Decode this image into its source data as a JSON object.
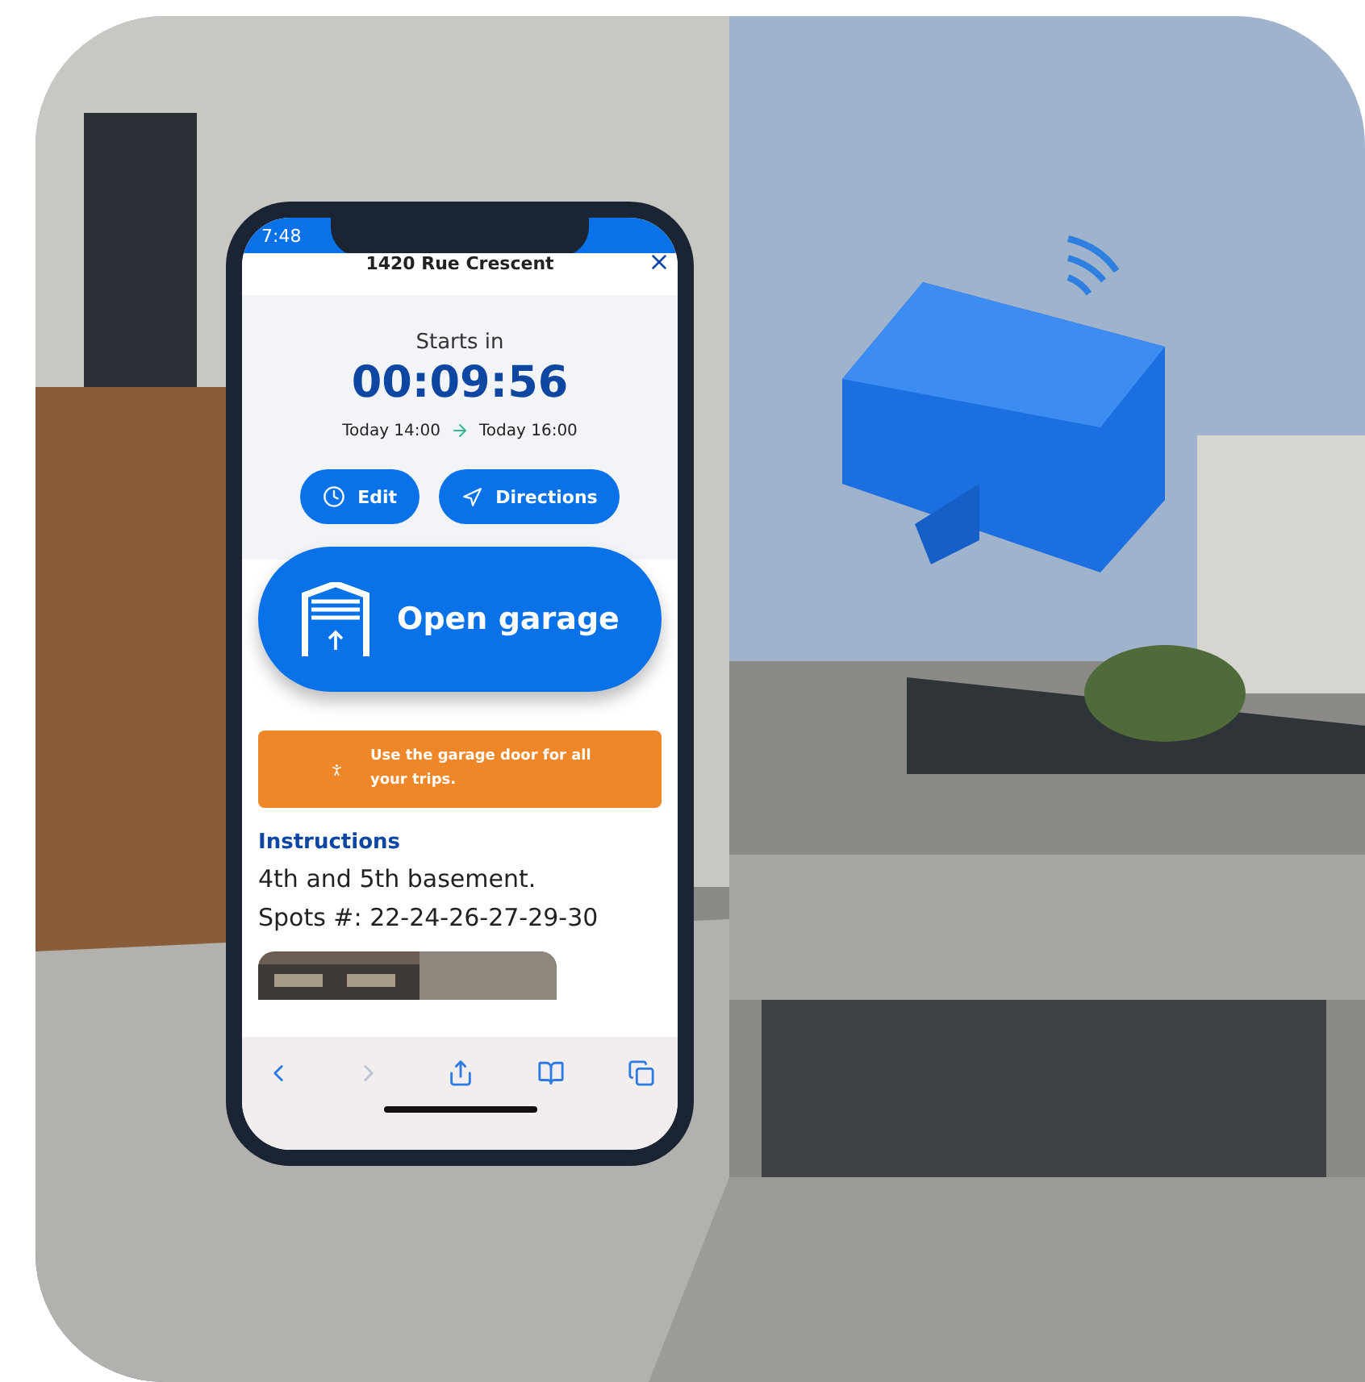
{
  "status_bar": {
    "time": "7:48"
  },
  "header": {
    "title": "1420 Rue Crescent"
  },
  "countdown": {
    "label": "Starts in",
    "timer": "00:09:56",
    "start": "Today 14:00",
    "end": "Today 16:00"
  },
  "actions": [
    {
      "kind": "edit",
      "label": "Edit"
    },
    {
      "kind": "directions",
      "label": "Directions"
    }
  ],
  "open_button": {
    "label": "Open garage"
  },
  "notice": {
    "text": "Use the garage door for all your trips."
  },
  "instructions": {
    "title": "Instructions",
    "lines": [
      "4th and 5th basement.",
      "Spots #: 22-24-26-27-29-30"
    ]
  },
  "browser_toolbar": [
    {
      "kind": "back",
      "disabled": false
    },
    {
      "kind": "forward",
      "disabled": true
    },
    {
      "kind": "share",
      "disabled": false
    },
    {
      "kind": "bookmarks",
      "disabled": false
    },
    {
      "kind": "tabs",
      "disabled": false
    }
  ]
}
